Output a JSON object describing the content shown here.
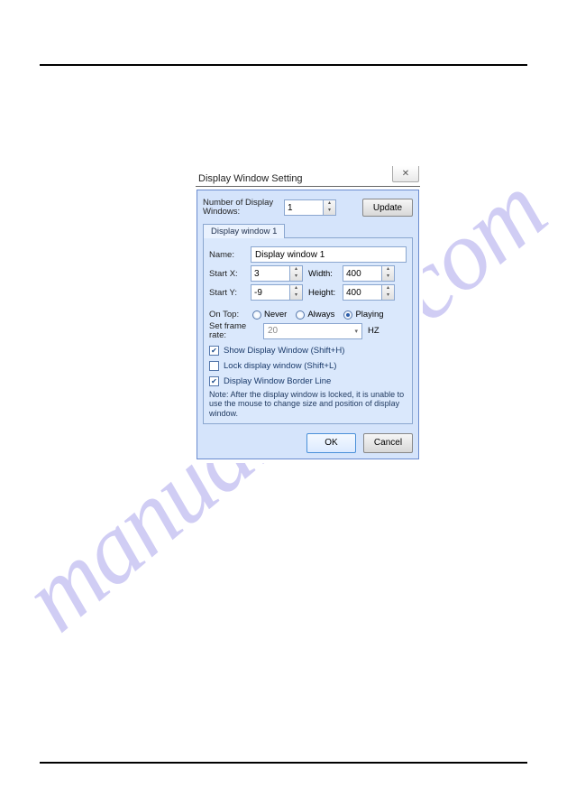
{
  "watermark": "manualslive.com",
  "dialog": {
    "title": "Display Window Setting",
    "numWindowsLabel": "Number of Display Windows:",
    "numWindowsValue": "1",
    "updateBtn": "Update",
    "tabLabel": "Display window 1",
    "nameLabel": "Name:",
    "nameValue": "Display window 1",
    "startXLabel": "Start X:",
    "startXValue": "3",
    "widthLabel": "Width:",
    "widthValue": "400",
    "startYLabel": "Start Y:",
    "startYValue": "-9",
    "heightLabel": "Height:",
    "heightValue": "400",
    "onTopLabel": "On Top:",
    "radioNever": "Never",
    "radioAlways": "Always",
    "radioPlaying": "Playing",
    "frameRateLabel": "Set frame rate:",
    "frameRateValue": "20",
    "hz": "HZ",
    "chkShow": "Show Display Window (Shift+H)",
    "chkLock": "Lock display window (Shift+L)",
    "chkBorder": "Display Window Border Line",
    "note": "Note: After the display window is locked, it is unable to use the mouse to change size and position of display window.",
    "okBtn": "OK",
    "cancelBtn": "Cancel"
  }
}
